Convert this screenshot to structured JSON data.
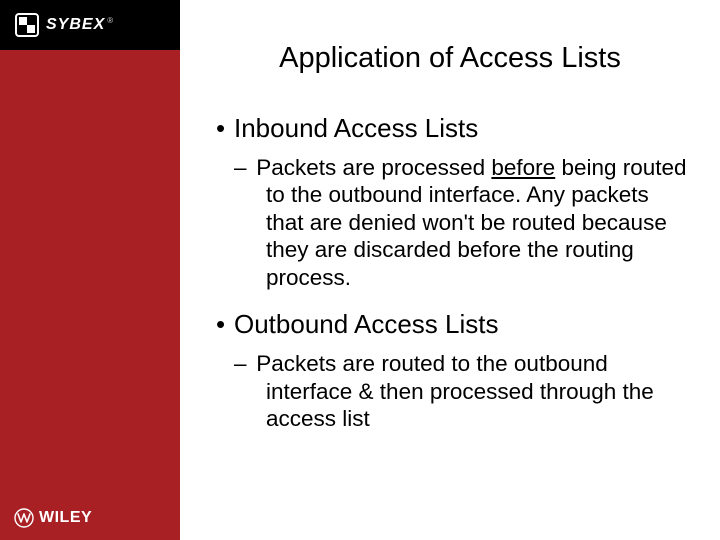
{
  "brand": {
    "sybex_text": "SYBEX",
    "sybex_registered": "®",
    "wiley_text": "WILEY"
  },
  "slide": {
    "title": "Application of Access Lists",
    "items": [
      {
        "bullet": "•",
        "label": "Inbound Access Lists",
        "sub_dash": "–",
        "sub_text_pre": "Packets are processed ",
        "sub_text_underlined": "before",
        "sub_text_post": " being routed to the outbound interface. Any packets that are denied won't be routed because they are discarded before the routing process."
      },
      {
        "bullet": "•",
        "label": "Outbound Access Lists",
        "sub_dash": "–",
        "sub_text_pre": "Packets are routed to the outbound interface & then processed through the access list",
        "sub_text_underlined": "",
        "sub_text_post": ""
      }
    ]
  }
}
